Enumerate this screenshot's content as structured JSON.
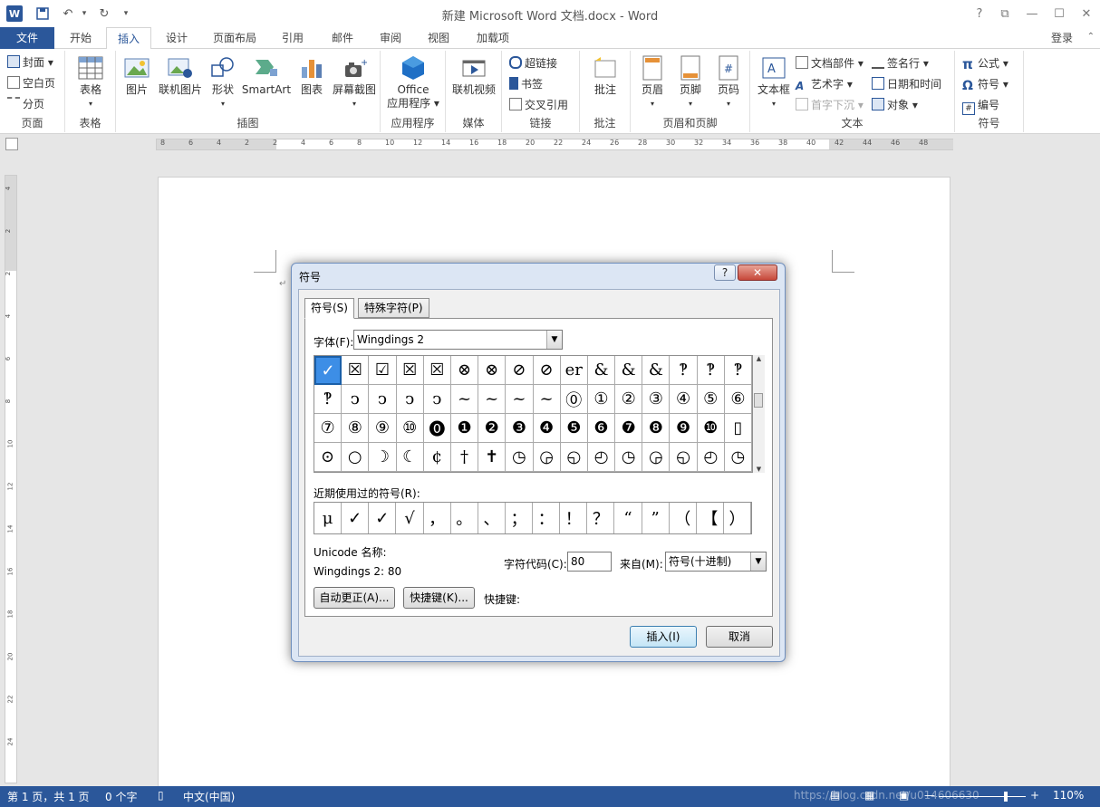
{
  "titlebar": {
    "title": "新建 Microsoft Word 文档.docx - Word",
    "help": "?",
    "restore_ribbon": "⧉",
    "minimize": "—",
    "maximize": "☐",
    "close": "✕"
  },
  "tabs": [
    {
      "label": "文件"
    },
    {
      "label": "开始"
    },
    {
      "label": "插入"
    },
    {
      "label": "设计"
    },
    {
      "label": "页面布局"
    },
    {
      "label": "引用"
    },
    {
      "label": "邮件"
    },
    {
      "label": "审阅"
    },
    {
      "label": "视图"
    },
    {
      "label": "加载项"
    }
  ],
  "login": "登录",
  "ribbon": {
    "pages": {
      "title": "页面",
      "cover": "封面 ▾",
      "blank": "空白页",
      "break": "分页"
    },
    "table": {
      "title": "表格",
      "table": "表格"
    },
    "illustrations": {
      "title": "插图",
      "picture": "图片",
      "online_picture": "联机图片",
      "shapes": "形状",
      "smartart": "SmartArt",
      "chart": "图表",
      "screenshot": "屏幕截图"
    },
    "apps": {
      "title": "应用程序",
      "office": "Office",
      "office2": "应用程序 ▾"
    },
    "media": {
      "title": "媒体",
      "video": "联机视频"
    },
    "links": {
      "title": "链接",
      "hyperlink": "超链接",
      "bookmark": "书签",
      "crossref": "交叉引用"
    },
    "comments": {
      "title": "批注",
      "comment": "批注"
    },
    "header_footer": {
      "title": "页眉和页脚",
      "header": "页眉",
      "footer": "页脚",
      "page_number": "页码"
    },
    "text": {
      "title": "文本",
      "textbox": "文本框",
      "quickparts": "文档部件 ▾",
      "wordart": "艺术字 ▾",
      "dropcap": "首字下沉 ▾",
      "signature": "签名行 ▾",
      "datetime": "日期和时间",
      "object": "对象 ▾"
    },
    "symbols": {
      "title": "符号",
      "equation": "公式 ▾",
      "symbol": "符号 ▾",
      "numbering": "编号"
    }
  },
  "ruler": {
    "numbers": [
      "8",
      "6",
      "4",
      "2",
      "2",
      "4",
      "6",
      "8",
      "10",
      "12",
      "14",
      "16",
      "18",
      "20",
      "22",
      "24",
      "26",
      "28",
      "30",
      "32",
      "34",
      "36",
      "38",
      "40",
      "42",
      "44",
      "46",
      "48"
    ]
  },
  "vruler": {
    "numbers": [
      "4",
      "2",
      "2",
      "4",
      "6",
      "8",
      "10",
      "12",
      "14",
      "16",
      "18",
      "20",
      "22",
      "24"
    ]
  },
  "dialog": {
    "title": "符号",
    "help": "?",
    "close": "✕",
    "tab_symbols": "符号(S)",
    "tab_special": "特殊字符(P)",
    "font_label": "字体(F):",
    "font_value": "Wingdings 2",
    "symbols": [
      "✓",
      "☒",
      "☑",
      "☒",
      "☒",
      "⊗",
      "⊗",
      "⊘",
      "⊘",
      "er",
      "&",
      "&",
      "&",
      "‽",
      "‽",
      "‽",
      "‽",
      "ↄ",
      "ↄ",
      "ↄ",
      "ↄ",
      "~",
      "~",
      "~",
      "~",
      "⓪",
      "①",
      "②",
      "③",
      "④",
      "⑤",
      "⑥",
      "⑦",
      "⑧",
      "⑨",
      "⑩",
      "⓿",
      "❶",
      "❷",
      "❸",
      "❹",
      "❺",
      "❻",
      "❼",
      "❽",
      "❾",
      "❿",
      "▯",
      "⊙",
      "○",
      "☽",
      "☾",
      "¢",
      "†",
      "✝",
      "◷",
      "◶",
      "◵",
      "◴",
      "◷",
      "◶",
      "◵",
      "◴",
      "◷"
    ],
    "recent_label": "近期使用过的符号(R):",
    "recent": [
      "μ",
      "✓",
      "✓",
      "√",
      "，",
      "。",
      "、",
      "；",
      "：",
      "！",
      "？",
      "“",
      "”",
      "（",
      "【",
      "）"
    ],
    "unicode_name_label": "Unicode 名称:",
    "char_name": "Wingdings 2: 80",
    "code_label": "字符代码(C):",
    "code_value": "80",
    "from_label": "来自(M):",
    "from_value": "符号(十进制)",
    "autocorrect": "自动更正(A)...",
    "shortcut_btn": "快捷键(K)...",
    "shortcut_label": "快捷键:",
    "insert": "插入(I)",
    "cancel": "取消"
  },
  "status": {
    "page": "第 1 页，共 1 页",
    "words": "0 个字",
    "lang": "中文(中国)",
    "watermark": "https://blog.csdn.net/u014606630",
    "zoom": "110%"
  }
}
